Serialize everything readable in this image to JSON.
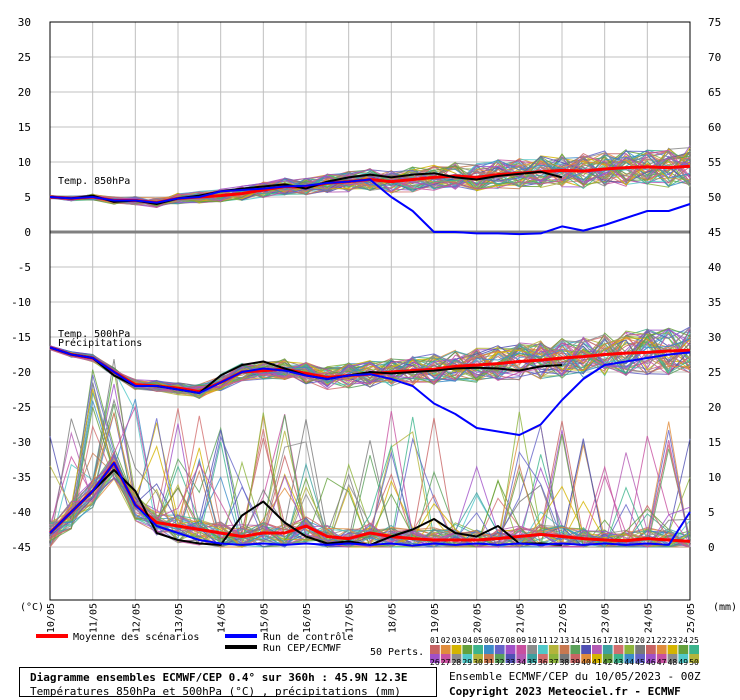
{
  "chart_data": {
    "type": "line",
    "title": "Diagramme ensembles ECMWF/CEP 0.4° sur 360h : 45.9N 12.3E",
    "subtitle": "Températures 850hPa et 500hPa (°C) , précipitations (mm)",
    "source": "Ensemble ECMWF/CEP du 10/05/2023 - 00Z",
    "copyright": "Copyright 2023 Meteociel.fr - ECMWF",
    "ylabel_left": "(°C)",
    "ylabel_right": "(mm)",
    "ylim_left": [
      -45,
      30
    ],
    "ylim_right": [
      0,
      75
    ],
    "yticks_left": [
      "30",
      "25",
      "20",
      "15",
      "10",
      "5",
      "0",
      "-5",
      "-10",
      "-15",
      "-20",
      "-25",
      "-30",
      "-35",
      "-40",
      "-45"
    ],
    "yticks_right": [
      "75",
      "70",
      "65",
      "60",
      "55",
      "50",
      "45",
      "40",
      "35",
      "30",
      "25",
      "20",
      "15",
      "10",
      "5",
      "0"
    ],
    "x_labels": [
      "10/05",
      "11/05",
      "12/05",
      "13/05",
      "14/05",
      "15/05",
      "16/05",
      "17/05",
      "18/05",
      "19/05",
      "20/05",
      "21/05",
      "22/05",
      "23/05",
      "24/05",
      "25/05"
    ],
    "annotations": {
      "t850": "Temp. 850hPa",
      "t500": "Temp. 500hPa",
      "precip": "Précipitations"
    },
    "legend": {
      "mean": "Moyenne des scénarios",
      "control": "Run de contrôle",
      "oper": "Run CEP/ECMWF",
      "perts": "50 Perts.",
      "members_top": [
        "01",
        "02",
        "03",
        "04",
        "05",
        "06",
        "07",
        "08",
        "09",
        "10",
        "11",
        "12",
        "13",
        "14",
        "15",
        "16",
        "17",
        "18",
        "19",
        "20",
        "21",
        "22",
        "23",
        "24",
        "25"
      ],
      "members_bottom": [
        "26",
        "27",
        "28",
        "29",
        "30",
        "31",
        "32",
        "33",
        "34",
        "35",
        "36",
        "37",
        "38",
        "39",
        "40",
        "41",
        "42",
        "43",
        "44",
        "45",
        "46",
        "47",
        "48",
        "49",
        "50"
      ]
    },
    "colors": {
      "mean": "#ff0000",
      "control": "#0000ff",
      "oper": "#000000",
      "grid": "#c0c0c0",
      "zero_line": "#808080"
    },
    "series": [
      {
        "name": "Moyenne des scénarios",
        "group": "t850",
        "values": [
          5,
          4.8,
          5,
          4.5,
          4.5,
          4.2,
          4.8,
          5,
          5.2,
          5.5,
          6,
          6.5,
          6.4,
          7,
          7.2,
          7.5,
          7.2,
          7.5,
          7.8,
          8,
          7.8,
          8.2,
          8.4,
          8.6,
          8.8,
          8.7,
          9,
          9.2,
          9.3,
          9.2,
          9.4
        ]
      },
      {
        "name": "Run CEP/ECMWF",
        "group": "t850",
        "values": [
          5,
          4.8,
          5.2,
          4.3,
          4.5,
          4,
          4.8,
          5.2,
          5.8,
          6.2,
          6.5,
          6.8,
          6.2,
          7.2,
          7.8,
          8.2,
          7.8,
          8.2,
          8.4,
          7.8,
          7.5,
          8,
          8.3,
          8.6,
          7.8
        ]
      },
      {
        "name": "Run de contrôle",
        "group": "t850",
        "values": [
          5,
          4.8,
          5,
          4.5,
          4.5,
          4.2,
          4.8,
          5,
          5.8,
          6,
          6.2,
          6.5,
          6.6,
          7,
          7.2,
          7.5,
          5,
          3,
          0,
          0,
          -0.2,
          -0.2,
          -0.3,
          -0.2,
          0.8,
          0.2,
          1,
          2,
          3,
          3,
          4
        ]
      },
      {
        "name": "Moyenne des scénarios",
        "group": "t500",
        "values": [
          -16.5,
          -17.5,
          -18,
          -20,
          -21.8,
          -22,
          -22.3,
          -22.8,
          -21.5,
          -20,
          -19.8,
          -19.6,
          -20.2,
          -20.8,
          -20.5,
          -20.3,
          -20,
          -19.8,
          -19.6,
          -19.2,
          -19,
          -18.8,
          -18.5,
          -18.3,
          -18,
          -17.8,
          -17.5,
          -17.3,
          -17.2,
          -17,
          -16.9
        ]
      },
      {
        "name": "Run CEP/ECMWF",
        "group": "t500",
        "values": [
          -16.5,
          -17.5,
          -18,
          -20.5,
          -22,
          -22,
          -22.5,
          -23,
          -20.5,
          -19,
          -18.5,
          -19.5,
          -20.5,
          -21,
          -20.5,
          -20,
          -20.2,
          -20,
          -19.8,
          -19.5,
          -19.4,
          -19.5,
          -19.8,
          -19.2,
          -19
        ]
      },
      {
        "name": "Run de contrôle",
        "group": "t500",
        "values": [
          -16.5,
          -17.5,
          -18,
          -20,
          -22,
          -22,
          -22.5,
          -23,
          -21.5,
          -20,
          -19.5,
          -19.8,
          -20.5,
          -21,
          -20.5,
          -20.3,
          -21,
          -22,
          -24.5,
          -26,
          -28,
          -28.5,
          -29,
          -27.5,
          -24,
          -21,
          -19,
          -18.5,
          -18,
          -17.5,
          -17.2
        ]
      },
      {
        "name": "Moyenne des scénarios",
        "group": "precip",
        "values": [
          2,
          5,
          8,
          12,
          6,
          3.5,
          3,
          2.5,
          2,
          1.5,
          2,
          2,
          3,
          1.5,
          1.2,
          2,
          1.5,
          1.2,
          1,
          1,
          1,
          1.2,
          1.5,
          1.8,
          1.5,
          1.2,
          1,
          0.9,
          1.2,
          1,
          0.8
        ]
      },
      {
        "name": "Run CEP/ECMWF",
        "group": "precip",
        "values": [
          2,
          5,
          8,
          11,
          8,
          2,
          1,
          0.5,
          0.3,
          4.5,
          6.5,
          3.5,
          1.5,
          0.5,
          0.8,
          0.3,
          1.5,
          2.5,
          4,
          2,
          1.5,
          3,
          0.5,
          0.5,
          0.3
        ]
      },
      {
        "name": "Run de contrôle",
        "group": "precip",
        "values": [
          2,
          5,
          8,
          12,
          6,
          3,
          2,
          1,
          0.5,
          0.3,
          0.5,
          0.3,
          0.5,
          0.3,
          0.5,
          0.3,
          0.5,
          0.2,
          0.5,
          0.3,
          0.5,
          0.3,
          0.5,
          0.3,
          0.5,
          0.3,
          0.5,
          0.3,
          0.5,
          0.3,
          5
        ]
      }
    ]
  }
}
